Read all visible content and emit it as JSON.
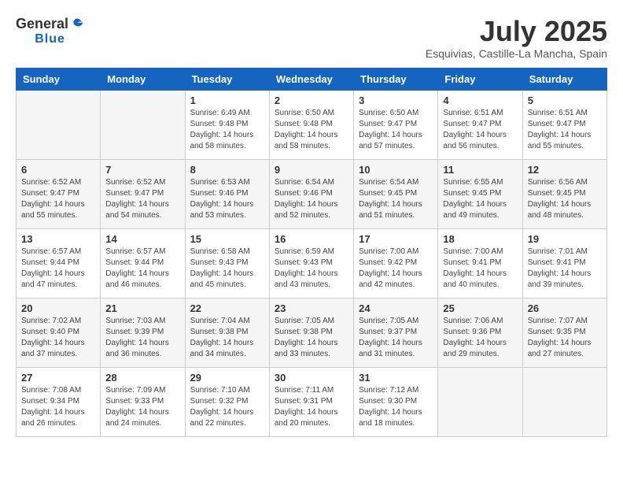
{
  "logo": {
    "general": "General",
    "blue": "Blue"
  },
  "title": "July 2025",
  "location": "Esquivias, Castille-La Mancha, Spain",
  "headers": [
    "Sunday",
    "Monday",
    "Tuesday",
    "Wednesday",
    "Thursday",
    "Friday",
    "Saturday"
  ],
  "weeks": [
    [
      {
        "day": "",
        "sunrise": "",
        "sunset": "",
        "daylight": ""
      },
      {
        "day": "",
        "sunrise": "",
        "sunset": "",
        "daylight": ""
      },
      {
        "day": "1",
        "sunrise": "Sunrise: 6:49 AM",
        "sunset": "Sunset: 9:48 PM",
        "daylight": "Daylight: 14 hours and 58 minutes."
      },
      {
        "day": "2",
        "sunrise": "Sunrise: 6:50 AM",
        "sunset": "Sunset: 9:48 PM",
        "daylight": "Daylight: 14 hours and 58 minutes."
      },
      {
        "day": "3",
        "sunrise": "Sunrise: 6:50 AM",
        "sunset": "Sunset: 9:47 PM",
        "daylight": "Daylight: 14 hours and 57 minutes."
      },
      {
        "day": "4",
        "sunrise": "Sunrise: 6:51 AM",
        "sunset": "Sunset: 9:47 PM",
        "daylight": "Daylight: 14 hours and 56 minutes."
      },
      {
        "day": "5",
        "sunrise": "Sunrise: 6:51 AM",
        "sunset": "Sunset: 9:47 PM",
        "daylight": "Daylight: 14 hours and 55 minutes."
      }
    ],
    [
      {
        "day": "6",
        "sunrise": "Sunrise: 6:52 AM",
        "sunset": "Sunset: 9:47 PM",
        "daylight": "Daylight: 14 hours and 55 minutes."
      },
      {
        "day": "7",
        "sunrise": "Sunrise: 6:52 AM",
        "sunset": "Sunset: 9:47 PM",
        "daylight": "Daylight: 14 hours and 54 minutes."
      },
      {
        "day": "8",
        "sunrise": "Sunrise: 6:53 AM",
        "sunset": "Sunset: 9:46 PM",
        "daylight": "Daylight: 14 hours and 53 minutes."
      },
      {
        "day": "9",
        "sunrise": "Sunrise: 6:54 AM",
        "sunset": "Sunset: 9:46 PM",
        "daylight": "Daylight: 14 hours and 52 minutes."
      },
      {
        "day": "10",
        "sunrise": "Sunrise: 6:54 AM",
        "sunset": "Sunset: 9:45 PM",
        "daylight": "Daylight: 14 hours and 51 minutes."
      },
      {
        "day": "11",
        "sunrise": "Sunrise: 6:55 AM",
        "sunset": "Sunset: 9:45 PM",
        "daylight": "Daylight: 14 hours and 49 minutes."
      },
      {
        "day": "12",
        "sunrise": "Sunrise: 6:56 AM",
        "sunset": "Sunset: 9:45 PM",
        "daylight": "Daylight: 14 hours and 48 minutes."
      }
    ],
    [
      {
        "day": "13",
        "sunrise": "Sunrise: 6:57 AM",
        "sunset": "Sunset: 9:44 PM",
        "daylight": "Daylight: 14 hours and 47 minutes."
      },
      {
        "day": "14",
        "sunrise": "Sunrise: 6:57 AM",
        "sunset": "Sunset: 9:44 PM",
        "daylight": "Daylight: 14 hours and 46 minutes."
      },
      {
        "day": "15",
        "sunrise": "Sunrise: 6:58 AM",
        "sunset": "Sunset: 9:43 PM",
        "daylight": "Daylight: 14 hours and 45 minutes."
      },
      {
        "day": "16",
        "sunrise": "Sunrise: 6:59 AM",
        "sunset": "Sunset: 9:43 PM",
        "daylight": "Daylight: 14 hours and 43 minutes."
      },
      {
        "day": "17",
        "sunrise": "Sunrise: 7:00 AM",
        "sunset": "Sunset: 9:42 PM",
        "daylight": "Daylight: 14 hours and 42 minutes."
      },
      {
        "day": "18",
        "sunrise": "Sunrise: 7:00 AM",
        "sunset": "Sunset: 9:41 PM",
        "daylight": "Daylight: 14 hours and 40 minutes."
      },
      {
        "day": "19",
        "sunrise": "Sunrise: 7:01 AM",
        "sunset": "Sunset: 9:41 PM",
        "daylight": "Daylight: 14 hours and 39 minutes."
      }
    ],
    [
      {
        "day": "20",
        "sunrise": "Sunrise: 7:02 AM",
        "sunset": "Sunset: 9:40 PM",
        "daylight": "Daylight: 14 hours and 37 minutes."
      },
      {
        "day": "21",
        "sunrise": "Sunrise: 7:03 AM",
        "sunset": "Sunset: 9:39 PM",
        "daylight": "Daylight: 14 hours and 36 minutes."
      },
      {
        "day": "22",
        "sunrise": "Sunrise: 7:04 AM",
        "sunset": "Sunset: 9:38 PM",
        "daylight": "Daylight: 14 hours and 34 minutes."
      },
      {
        "day": "23",
        "sunrise": "Sunrise: 7:05 AM",
        "sunset": "Sunset: 9:38 PM",
        "daylight": "Daylight: 14 hours and 33 minutes."
      },
      {
        "day": "24",
        "sunrise": "Sunrise: 7:05 AM",
        "sunset": "Sunset: 9:37 PM",
        "daylight": "Daylight: 14 hours and 31 minutes."
      },
      {
        "day": "25",
        "sunrise": "Sunrise: 7:06 AM",
        "sunset": "Sunset: 9:36 PM",
        "daylight": "Daylight: 14 hours and 29 minutes."
      },
      {
        "day": "26",
        "sunrise": "Sunrise: 7:07 AM",
        "sunset": "Sunset: 9:35 PM",
        "daylight": "Daylight: 14 hours and 27 minutes."
      }
    ],
    [
      {
        "day": "27",
        "sunrise": "Sunrise: 7:08 AM",
        "sunset": "Sunset: 9:34 PM",
        "daylight": "Daylight: 14 hours and 26 minutes."
      },
      {
        "day": "28",
        "sunrise": "Sunrise: 7:09 AM",
        "sunset": "Sunset: 9:33 PM",
        "daylight": "Daylight: 14 hours and 24 minutes."
      },
      {
        "day": "29",
        "sunrise": "Sunrise: 7:10 AM",
        "sunset": "Sunset: 9:32 PM",
        "daylight": "Daylight: 14 hours and 22 minutes."
      },
      {
        "day": "30",
        "sunrise": "Sunrise: 7:11 AM",
        "sunset": "Sunset: 9:31 PM",
        "daylight": "Daylight: 14 hours and 20 minutes."
      },
      {
        "day": "31",
        "sunrise": "Sunrise: 7:12 AM",
        "sunset": "Sunset: 9:30 PM",
        "daylight": "Daylight: 14 hours and 18 minutes."
      },
      {
        "day": "",
        "sunrise": "",
        "sunset": "",
        "daylight": ""
      },
      {
        "day": "",
        "sunrise": "",
        "sunset": "",
        "daylight": ""
      }
    ]
  ]
}
